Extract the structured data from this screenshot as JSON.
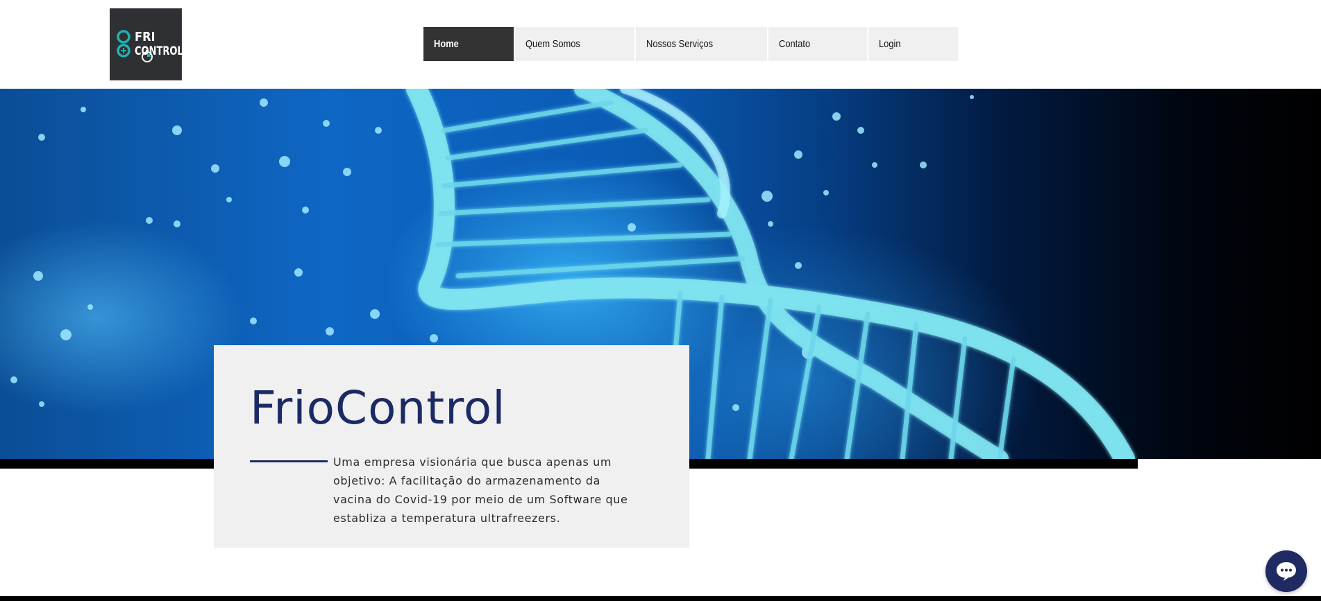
{
  "header": {
    "logo": {
      "line1": "FRI",
      "line2": "CONTROL",
      "brand_colors": {
        "background": "#2f3033",
        "accent": "#1fb3b1"
      }
    },
    "nav": [
      {
        "label": "Home",
        "active": true
      },
      {
        "label": "Quem Somos",
        "active": false
      },
      {
        "label": "Nossos Serviços",
        "active": false
      },
      {
        "label": "Contato",
        "active": false
      },
      {
        "label": "Login",
        "active": false
      }
    ]
  },
  "hero": {
    "title": "FrioControl",
    "description": "Uma empresa visionária que busca apenas um objetivo: A facilitação do armazenamento da vacina do Covid-19 por meio de um Software que establiza a temperatura ultrafreezers.",
    "image_subject": "dna-helix",
    "colors": {
      "title": "#1c2a64",
      "card_background": "#f0f0f1"
    }
  },
  "chat_widget": {
    "icon": "chat-bubble-icon",
    "color": "#1f2a63"
  }
}
